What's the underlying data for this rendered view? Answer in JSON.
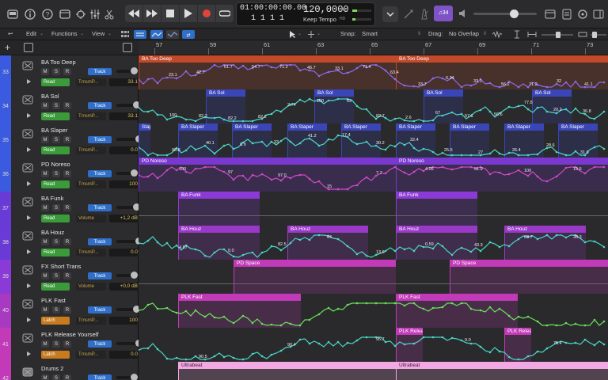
{
  "control_bar": {
    "lcd": {
      "time": "01:00:00:00.00",
      "bars": "1  1  1  1",
      "tempo": "120,0000",
      "tempo_mode": "Keep Tempo",
      "cpu_label": "CPU",
      "hd_label": "HD"
    },
    "chord_label": "♫34"
  },
  "toolbar": {
    "edit": "Edit",
    "functions": "Functions",
    "view": "View",
    "snap_label": "Snap:",
    "snap_value": "Smart",
    "drag_label": "Drag:",
    "drag_value": "No Overlap"
  },
  "ruler": {
    "bars": [
      "57",
      "59",
      "61",
      "63",
      "65",
      "67",
      "69",
      "71",
      "73"
    ]
  },
  "tracks": [
    {
      "num": "33",
      "name": "BA Too Deep",
      "mode": "Read",
      "param": "TrnsmP...",
      "value": "33.1",
      "color": "#c24a2a",
      "num_bg": "#3a5be0",
      "regions": [
        {
          "label": "BA Too Deep"
        },
        {
          "label": "BA Too Deep"
        }
      ],
      "labels": [
        "23.1",
        "42.7",
        "61.7",
        "54.7",
        "71.2",
        "46.7",
        "33.1",
        "71.4",
        "63.4",
        "33.7",
        "6.34",
        "33.1",
        "56.2",
        "71.2",
        "32",
        "41.1"
      ]
    },
    {
      "num": "34",
      "name": "BA Sol",
      "mode": "Read",
      "param": "TrnsmP...",
      "value": "33.1",
      "color": "#3a46b8",
      "num_bg": "#3a5be0",
      "regions": [
        {
          "label": "BA Sol"
        },
        {
          "label": "BA Sol"
        },
        {
          "label": "BA Sol"
        },
        {
          "label": "BA Sol"
        }
      ],
      "labels": [
        "100",
        "82.3",
        "82.2",
        "82.2",
        "2.74",
        "100",
        "63",
        "82.7",
        "2.6",
        "67",
        "57.1",
        "56.6",
        "77.8",
        "20.2",
        "36.8"
      ]
    },
    {
      "num": "35",
      "name": "BA Slaper",
      "mode": "Read",
      "param": "TrnsmP...",
      "value": "0.0",
      "color": "#3a46b8",
      "num_bg": "#3a5be0",
      "regions": [
        {
          "label": "Slaper"
        },
        {
          "label": "BA Slaper"
        },
        {
          "label": "BA Slaper"
        },
        {
          "label": "BA Slaper"
        },
        {
          "label": "BA Slaper"
        },
        {
          "label": "BA Slaper"
        },
        {
          "label": "BA Slaper"
        },
        {
          "label": "BA Slaper"
        },
        {
          "label": "BA Slaper"
        },
        {
          "label": "BA Slaper"
        }
      ],
      "labels": [
        "98.8",
        "40.1",
        "8.9",
        "33",
        "41.2",
        "17.4",
        "30.2",
        "32.4",
        "25.5",
        "27",
        "26.4",
        "28.6",
        "31.6"
      ]
    },
    {
      "num": "36",
      "name": "PD Noreso",
      "mode": "Read",
      "param": "TrnsmP...",
      "value": "100",
      "color": "#8c3ad6",
      "num_bg": "#3a5be0",
      "regions": [
        {
          "label": "PD Noreso"
        },
        {
          "label": "PD Noreso"
        }
      ],
      "labels": [
        "100",
        "97",
        "97.0",
        "15",
        "7.7",
        "4.06",
        "91.9",
        "100",
        "19.6"
      ]
    },
    {
      "num": "37",
      "name": "BA Funk",
      "mode": "Read",
      "param": "Volume",
      "value": "+1,2 dB",
      "color": "#8c3ad6",
      "num_bg": "#6a3ad6",
      "regions": [
        {
          "label": "BA Funk"
        },
        {
          "label": "BA Funk"
        }
      ],
      "labels": []
    },
    {
      "num": "38",
      "name": "BA Houz",
      "mode": "Read",
      "param": "TrnsmP...",
      "value": "0.0",
      "color": "#9a38c8",
      "num_bg": "#6a3ad6",
      "regions": [
        {
          "label": "BA Houz"
        },
        {
          "label": "BA Houz"
        },
        {
          "label": "BA Houz"
        },
        {
          "label": "BA Houz"
        }
      ],
      "labels": [
        "4.87",
        "0.0",
        "82.5",
        "64",
        "13.6",
        "0.59",
        "43.3",
        "63.7",
        "38.3"
      ]
    },
    {
      "num": "39",
      "name": "FX Short Trans",
      "mode": "Read",
      "param": "Volume",
      "value": "+0,0 dB",
      "color": "#c23ab8",
      "num_bg": "#8a3ad6",
      "regions": [
        {
          "label": "PD Space"
        },
        {
          "label": "PD Space"
        }
      ],
      "labels": []
    },
    {
      "num": "40",
      "name": "PLK Fast",
      "mode": "Latch",
      "param": "TrnsmP...",
      "value": "100",
      "color": "#c23ab8",
      "num_bg": "#a83ac2",
      "regions": [
        {
          "label": "PLK Fast"
        },
        {
          "label": "PLK Fast"
        }
      ],
      "labels": []
    },
    {
      "num": "41",
      "name": "PLK Release Yourself",
      "mode": "Latch",
      "param": "TrnsmP...",
      "value": "0.0",
      "color": "#c23ab8",
      "num_bg": "#c23ab8",
      "regions": [
        {
          "label": "PLK Relea"
        },
        {
          "label": "PLK Releas"
        }
      ],
      "labels": [
        "90.5",
        "90.4",
        "95.7",
        "0.0",
        "75.4"
      ]
    },
    {
      "num": "42",
      "name": "Drums 2",
      "mode": "",
      "param": "",
      "value": "",
      "color": "#d98acb",
      "num_bg": "#c23ab8",
      "regions": [
        {
          "label": "Ultrabeat"
        },
        {
          "label": "Ultrabeat"
        }
      ],
      "labels": []
    }
  ]
}
